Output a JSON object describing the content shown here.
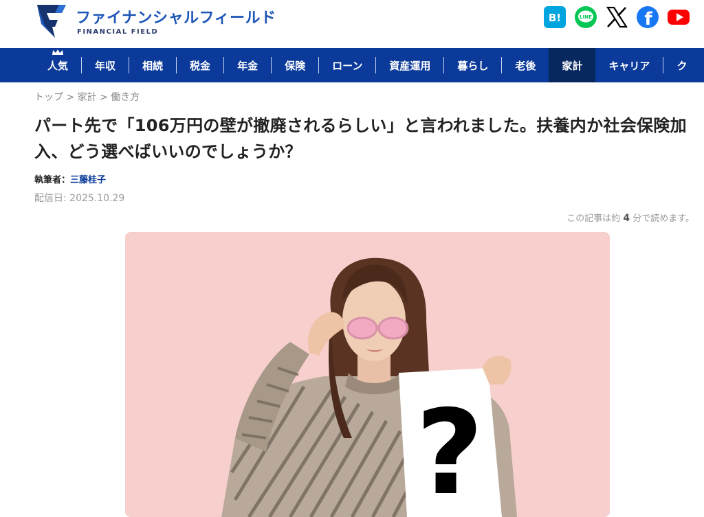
{
  "header": {
    "logo_jp": "ファイナンシャルフィールド",
    "logo_en": "FINANCIAL FIELD",
    "social": [
      {
        "name": "hatena-bookmark-icon",
        "label": "B!",
        "color": "#00a4de"
      },
      {
        "name": "line-icon",
        "label": "LINE",
        "color": "#06c755"
      },
      {
        "name": "x-icon",
        "label": "X",
        "color": "#000000"
      },
      {
        "name": "facebook-icon",
        "label": "f",
        "color": "#1877f2"
      },
      {
        "name": "youtube-icon",
        "label": "",
        "color": "#ff0000"
      }
    ]
  },
  "nav": {
    "items": [
      "人気",
      "年収",
      "相続",
      "税金",
      "年金",
      "保険",
      "ローン",
      "資産運用",
      "暮らし",
      "老後",
      "家計",
      "キャリア",
      "ク"
    ],
    "active": "家計"
  },
  "breadcrumb": {
    "items": [
      "トップ",
      "家計",
      "働き方"
    ],
    "separator": ">"
  },
  "article": {
    "title": "パート先で「106万円の壁が撤廃されるらしい」と言われました。扶養内か社会保険加入、どう選べばいいのでしょうか？",
    "author_label": "執筆者：",
    "author_name": "三藤桂子",
    "date": "配信日: 2025.10.29",
    "readtime_pre": "この記事は約",
    "readtime_num": "4",
    "readtime_post": "分で読めます。",
    "hero_bg": "#f7cfcd"
  }
}
